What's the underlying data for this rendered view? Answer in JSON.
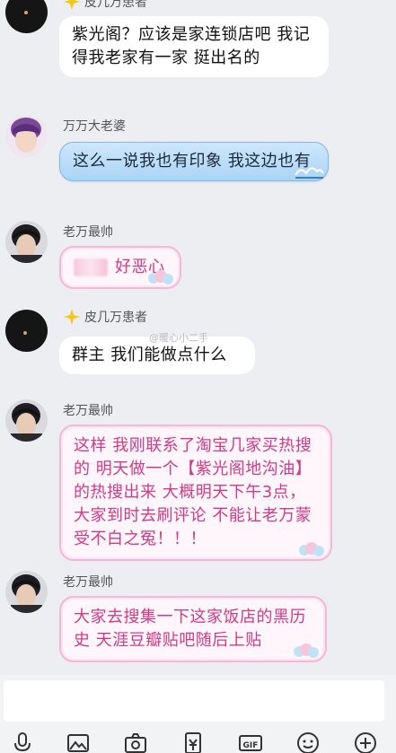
{
  "messages": [
    {
      "sender": "皮几万患者",
      "text": "紫光阁？应该是家连锁店吧 我记得我老家有一家 挺出名的",
      "style": "white"
    },
    {
      "sender": "万万大老婆",
      "text": "这么一说我也有印象 我这边也有",
      "style": "blue"
    },
    {
      "sender": "老万最帅",
      "text": "好恶心",
      "style": "pink"
    },
    {
      "sender": "皮几万患者",
      "text": "群主 我们能做点什么",
      "style": "white"
    },
    {
      "sender": "老万最帅",
      "text": "这样 我刚联系了淘宝几家买热搜的 明天做一个【紫光阁地沟油】的热搜出来 大概明天下午3点，大家到时去刷评论 不能让老万蒙受不白之冤！！！",
      "style": "pink"
    },
    {
      "sender": "老万最帅",
      "text": "大家去搜集一下这家饭店的黑历史 天涯豆瓣贴吧随后上贴",
      "style": "pink"
    }
  ],
  "watermark": "@暖心小二手",
  "toolbar": {
    "icons": [
      "microphone-icon",
      "image-icon",
      "camera-icon",
      "red-packet-icon",
      "gif-icon",
      "emoji-icon",
      "plus-icon"
    ],
    "gif_label": "GIF"
  },
  "colors": {
    "background": "#eceef2",
    "pink_text": "#d23a86",
    "pink_border": "#f2b8d8",
    "blue_bubble": "#a9d4f6"
  }
}
